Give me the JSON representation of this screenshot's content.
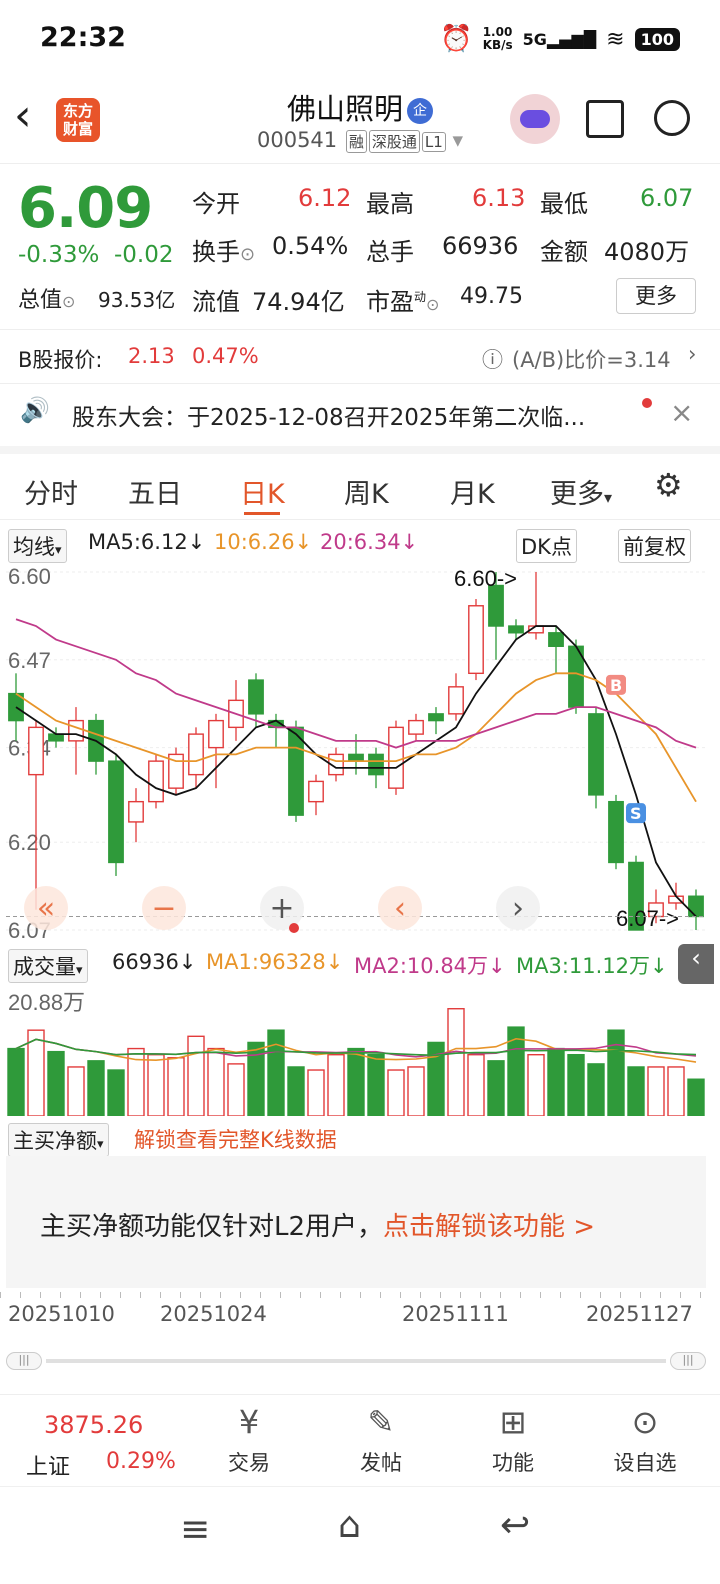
{
  "status": {
    "time": "22:32",
    "speed": "1.00\nKB/s",
    "net": "5G",
    "battery": "100"
  },
  "header": {
    "back": "‹",
    "logo_line1": "东方",
    "logo_line2": "财富",
    "name": "佛山照明",
    "badge": "企",
    "code": "000541",
    "tag1": "融",
    "tag2": "深股通",
    "tag3": "L1"
  },
  "quote": {
    "price": "6.09",
    "change_pct": "-0.33%",
    "change": "-0.02",
    "open_label": "今开",
    "open": "6.12",
    "high_label": "最高",
    "high": "6.13",
    "low_label": "最低",
    "low": "6.07",
    "turnover_label": "换手",
    "turnover": "0.54%",
    "volume_label": "总手",
    "volume": "66936",
    "amount_label": "金额",
    "amount": "4080万",
    "mktcap_label": "总值",
    "mktcap": "93.53亿",
    "float_label": "流值",
    "float": "74.94亿",
    "pe_label": "市盈",
    "pe_sup": "动",
    "pe": "49.75",
    "more": "更多"
  },
  "bshare": {
    "label": "B股报价:",
    "price": "2.13",
    "pct": "0.47%",
    "ratio": "(A/B)比价=3.14"
  },
  "notice": {
    "text": "股东大会：于2025-12-08召开2025年第二次临..."
  },
  "tabs": [
    "分时",
    "五日",
    "日K",
    "周K",
    "月K",
    "更多"
  ],
  "ma": {
    "selector": "均线",
    "ma5": "MA5:6.12↓",
    "ma10": "10:6.26↓",
    "ma20": "20:6.34↓",
    "dk": "DK点",
    "fq": "前复权"
  },
  "chart_data": {
    "type": "candlestick",
    "y_ticks": [
      "6.60",
      "6.47",
      "6.34",
      "6.20",
      "6.07"
    ],
    "ylim": [
      6.07,
      6.6
    ],
    "annotations": {
      "high": "6.60->",
      "low": "6.07->",
      "buy": "B",
      "sell": "S"
    },
    "candles": [
      [
        6.42,
        6.38,
        6.45,
        6.35
      ],
      [
        6.3,
        6.37,
        6.38,
        6.1
      ],
      [
        6.36,
        6.35,
        6.37,
        6.34
      ],
      [
        6.35,
        6.38,
        6.4,
        6.3
      ],
      [
        6.38,
        6.32,
        6.39,
        6.3
      ],
      [
        6.32,
        6.17,
        6.33,
        6.15
      ],
      [
        6.23,
        6.26,
        6.28,
        6.2
      ],
      [
        6.26,
        6.32,
        6.33,
        6.25
      ],
      [
        6.28,
        6.33,
        6.34,
        6.27
      ],
      [
        6.3,
        6.36,
        6.37,
        6.28
      ],
      [
        6.34,
        6.38,
        6.39,
        6.28
      ],
      [
        6.37,
        6.41,
        6.44,
        6.35
      ],
      [
        6.44,
        6.39,
        6.45,
        6.37
      ],
      [
        6.38,
        6.37,
        6.39,
        6.34
      ],
      [
        6.37,
        6.24,
        6.38,
        6.23
      ],
      [
        6.26,
        6.29,
        6.3,
        6.24
      ],
      [
        6.3,
        6.33,
        6.34,
        6.29
      ],
      [
        6.33,
        6.32,
        6.36,
        6.3
      ],
      [
        6.33,
        6.3,
        6.34,
        6.28
      ],
      [
        6.28,
        6.37,
        6.38,
        6.27
      ],
      [
        6.36,
        6.38,
        6.39,
        6.35
      ],
      [
        6.39,
        6.38,
        6.4,
        6.36
      ],
      [
        6.39,
        6.43,
        6.45,
        6.38
      ],
      [
        6.45,
        6.55,
        6.56,
        6.44
      ],
      [
        6.58,
        6.52,
        6.6,
        6.47
      ],
      [
        6.52,
        6.51,
        6.53,
        6.5
      ],
      [
        6.51,
        6.52,
        6.6,
        6.5
      ],
      [
        6.51,
        6.49,
        6.52,
        6.45
      ],
      [
        6.49,
        6.4,
        6.5,
        6.39
      ],
      [
        6.39,
        6.27,
        6.4,
        6.25
      ],
      [
        6.26,
        6.17,
        6.27,
        6.16
      ],
      [
        6.17,
        6.07,
        6.18,
        6.07
      ],
      [
        6.09,
        6.11,
        6.13,
        6.08
      ],
      [
        6.11,
        6.12,
        6.14,
        6.1
      ],
      [
        6.12,
        6.09,
        6.13,
        6.07
      ]
    ],
    "ma_series": [
      {
        "name": "MA5",
        "color": "#111111",
        "values": [
          6.4,
          6.38,
          6.36,
          6.36,
          6.35,
          6.33,
          6.3,
          6.28,
          6.27,
          6.28,
          6.31,
          6.34,
          6.37,
          6.38,
          6.36,
          6.33,
          6.31,
          6.31,
          6.31,
          6.31,
          6.33,
          6.35,
          6.37,
          6.42,
          6.46,
          6.5,
          6.52,
          6.52,
          6.49,
          6.44,
          6.36,
          6.27,
          6.17,
          6.12,
          6.09
        ]
      },
      {
        "name": "MA10",
        "color": "#e8952a",
        "values": [
          6.42,
          6.4,
          6.38,
          6.37,
          6.36,
          6.35,
          6.34,
          6.33,
          6.32,
          6.32,
          6.33,
          6.33,
          6.34,
          6.34,
          6.34,
          6.33,
          6.32,
          6.32,
          6.32,
          6.32,
          6.33,
          6.33,
          6.34,
          6.36,
          6.39,
          6.42,
          6.44,
          6.45,
          6.45,
          6.44,
          6.42,
          6.39,
          6.36,
          6.31,
          6.26
        ]
      },
      {
        "name": "MA20",
        "color": "#c03a8a",
        "values": [
          6.53,
          6.52,
          6.5,
          6.49,
          6.48,
          6.47,
          6.45,
          6.44,
          6.42,
          6.41,
          6.4,
          6.39,
          6.38,
          6.37,
          6.37,
          6.36,
          6.35,
          6.35,
          6.35,
          6.34,
          6.35,
          6.35,
          6.35,
          6.36,
          6.37,
          6.38,
          6.39,
          6.39,
          6.4,
          6.4,
          6.39,
          6.38,
          6.37,
          6.35,
          6.34
        ]
      }
    ],
    "volume": {
      "max_label": "20.88万",
      "values": [
        11,
        14,
        10.5,
        8,
        9,
        7.5,
        11,
        10,
        9.5,
        13,
        11,
        8.5,
        12,
        14,
        8,
        7.5,
        10,
        11,
        10,
        7.5,
        8,
        12,
        17.5,
        10,
        9,
        14.5,
        10,
        11,
        10,
        8.5,
        14,
        8,
        8,
        8,
        6
      ]
    }
  },
  "vol": {
    "selector": "成交量",
    "value": "66936↓",
    "ma1": "MA1:96328↓",
    "ma2": "MA2:10.84万↓",
    "ma3": "MA3:11.12万↓"
  },
  "net": {
    "selector": "主买净额",
    "unlock": "解锁查看完整K线数据",
    "msg": "主买净额功能仅针对L2用户，",
    "link": "点击解锁该功能 >"
  },
  "dates": [
    "20251010",
    "20251024",
    "20251111",
    "20251127"
  ],
  "bottom": {
    "index_value": "3875.26",
    "index_name": "上证",
    "index_pct": "0.29%",
    "nav": [
      "交易",
      "发帖",
      "功能",
      "设自选"
    ]
  },
  "colors": {
    "up": "#e23b3b",
    "down": "#2f9a3a",
    "accent": "#e2562a"
  }
}
